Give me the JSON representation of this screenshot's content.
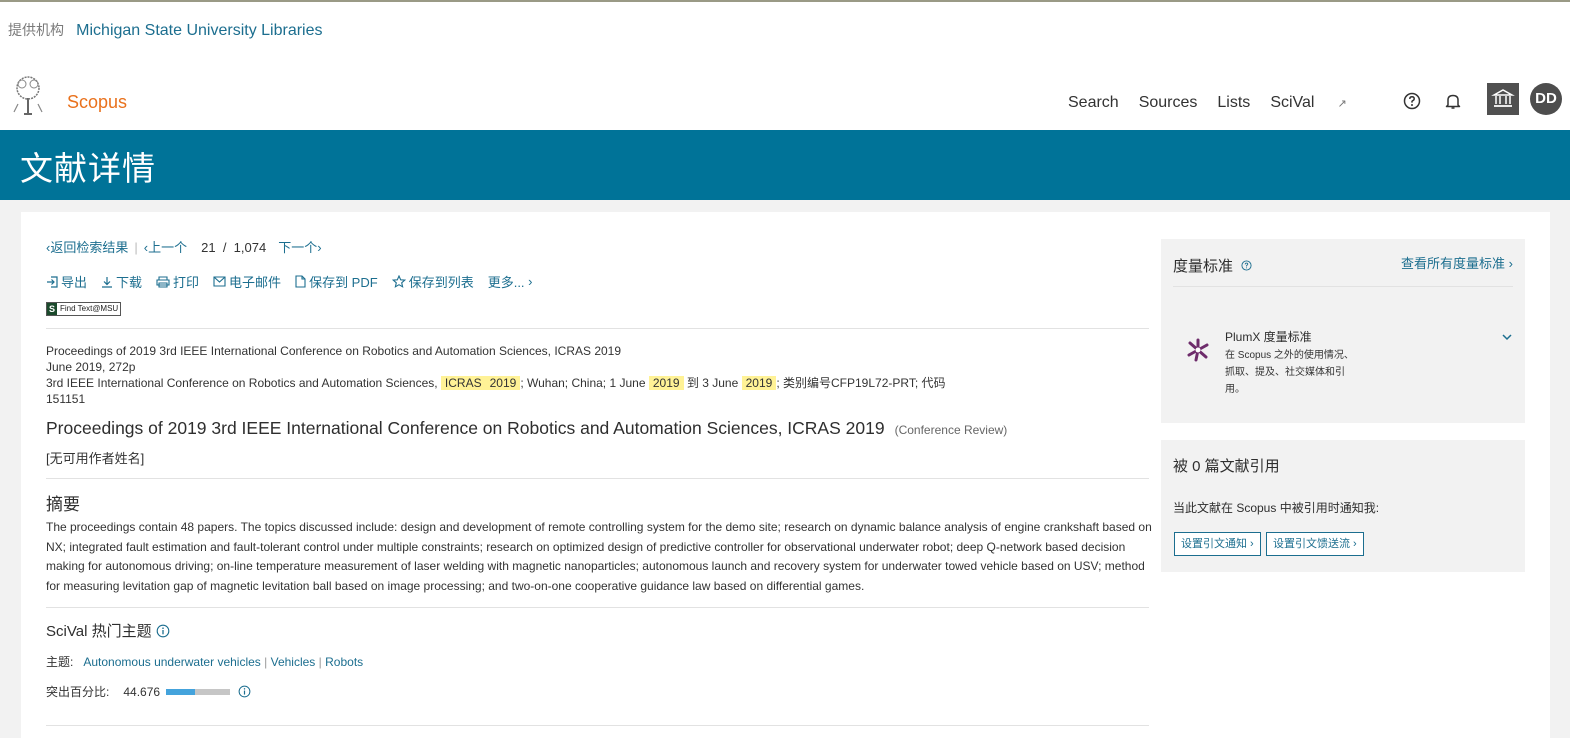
{
  "provider": {
    "label": "提供机构",
    "institution": "Michigan State University Libraries"
  },
  "header": {
    "brand": "Scopus",
    "nav": [
      "Search",
      "Sources",
      "Lists",
      "SciVal"
    ],
    "nav_external_mark": "↗",
    "avatar_initials": "DD",
    "icons": [
      "help-icon",
      "bell-icon",
      "institution-icon"
    ]
  },
  "banner": {
    "title": "文献详情"
  },
  "navrow": {
    "back": "返回检索结果",
    "prev": "上一个",
    "current": "21",
    "slash": "/",
    "total": "1,074",
    "next": "下一个"
  },
  "actions": [
    "导出",
    "下载",
    "打印",
    "电子邮件",
    "保存到 PDF",
    "保存到列表",
    "更多..."
  ],
  "findtext": {
    "s": "S",
    "label": "Find Text@MSU"
  },
  "meta": {
    "line1": "Proceedings of 2019 3rd IEEE International Conference on Robotics and Automation Sciences, ICRAS 2019",
    "line2": "June 2019, 272p",
    "line3_a": "3rd IEEE International Conference on Robotics and Automation Sciences,",
    "hl_icras": "ICRAS",
    "hl_2019a": "2019",
    "line3_b": "; Wuhan; China; 1 June",
    "hl_2019b": "2019",
    "line3_c": "到 3 June",
    "hl_2019c": "2019",
    "line3_d": "; 类别编号CFP19L72-PRT; 代码 151151"
  },
  "document": {
    "title": "Proceedings of 2019 3rd IEEE International Conference on Robotics and Automation Sciences, ICRAS 2019",
    "type": "(Conference Review)",
    "authors": "[无可用作者姓名]"
  },
  "abstract": {
    "heading": "摘要",
    "text": "The proceedings contain 48 papers. The topics discussed include: design and development of remote controlling system for the demo site; research on dynamic balance analysis of engine crankshaft based on NX; integrated fault estimation and fault-tolerant control under multiple constraints; research on optimized design of predictive controller for observational underwater robot; deep Q-network based decision making for autonomous driving; on-line temperature measurement of laser welding with magnetic nanoparticles; autonomous launch and recovery system for underwater towed vehicle based on USV; method for measuring levitation gap of magnetic levitation ball based on image processing; and two-on-one cooperative guidance law based on differential games."
  },
  "scival": {
    "heading": "SciVal 热门主题",
    "topic_label": "主题:",
    "topics": [
      "Autonomous underwater vehicles",
      "Vehicles",
      "Robots"
    ],
    "topic_sep": "|",
    "percentile_label": "突出百分比:",
    "percentile_value": "44.676",
    "percentile_fraction": 0.45
  },
  "metrics": {
    "heading": "度量标准",
    "view_all": "查看所有度量标准",
    "plumx_title": "PlumX 度量标准",
    "plumx_desc": "在 Scopus 之外的使用情况、抓取、提及、社交媒体和引用。"
  },
  "cited": {
    "heading": "被 0 篇文献引用",
    "desc": "当此文献在 Scopus 中被引用时通知我:",
    "btn_alert": "设置引文通知",
    "btn_feed": "设置引文馈送流"
  },
  "colors": {
    "brand_orange": "#e9711c",
    "banner_blue": "#007398",
    "link_blue": "#1c6e8f",
    "highlight": "#fff296"
  }
}
